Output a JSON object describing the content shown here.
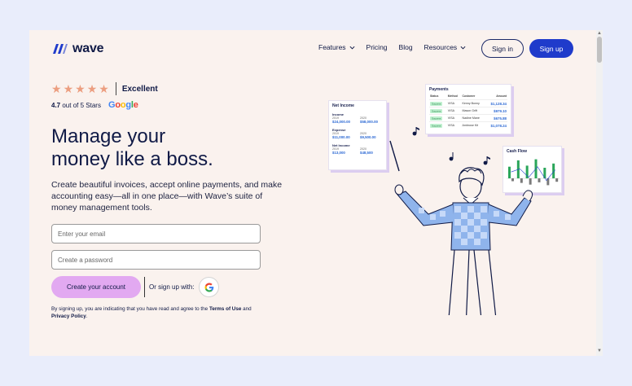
{
  "brand": {
    "name": "wave"
  },
  "nav": {
    "items": [
      {
        "label": "Features",
        "has_dropdown": true
      },
      {
        "label": "Pricing",
        "has_dropdown": false
      },
      {
        "label": "Blog",
        "has_dropdown": false
      },
      {
        "label": "Resources",
        "has_dropdown": true
      }
    ],
    "sign_in": "Sign in",
    "sign_up": "Sign up"
  },
  "rating": {
    "stars": 5,
    "label": "Excellent",
    "score": "4.7",
    "score_suffix": "out of 5 Stars",
    "source": "Google"
  },
  "hero": {
    "title_line1": "Manage your",
    "title_line2": "money like a boss.",
    "description": "Create beautiful invoices, accept online payments, and make accounting easy—all in one place—with Wave’s suite of money management tools."
  },
  "form": {
    "email_placeholder": "Enter your email",
    "password_placeholder": "Create a password",
    "create_label": "Create your account",
    "or_label": "Or sign up with:",
    "terms_prefix": "By signing up, you are indicating that you have read and agree to the ",
    "terms_link": "Terms of Use",
    "terms_and": " and ",
    "privacy_link": "Privacy Policy",
    "terms_suffix": "."
  },
  "illustration": {
    "payments": {
      "title": "Payments",
      "headers": [
        "Status",
        "Method",
        "Customer",
        "Amount"
      ],
      "rows": [
        {
          "status": "Success",
          "method": "VISA",
          "customer": "Kenny Bonny",
          "amount": "$1,128.34"
        },
        {
          "status": "Success",
          "method": "VISA",
          "customer": "Mason Grift",
          "amount": "$979.10"
        },
        {
          "status": "Success",
          "method": "VISA",
          "customer": "Nadine Mane",
          "amount": "$675.88"
        },
        {
          "status": "Success",
          "method": "VISA",
          "customer": "Ambrose Kit",
          "amount": "$1,078.24"
        }
      ]
    },
    "net_income_card": {
      "title": "Net Income",
      "sections": [
        {
          "label": "Income",
          "y1": "2019",
          "y2": "2020",
          "v1": "$24,000.00",
          "v2": "$58,000.00"
        },
        {
          "label": "Expense",
          "y1": "2019",
          "y2": "2020",
          "v1": "$11,000.00",
          "v2": "$9,500.00"
        },
        {
          "label": "Net Income",
          "y1": "2019",
          "y2": "2020",
          "v1": "$13,000",
          "v2": "$48,500"
        }
      ]
    },
    "cash_flow": {
      "title": "Cash Flow",
      "bars": [
        {
          "inflow": 0.55,
          "outflow": 0.25
        },
        {
          "inflow": 0.85,
          "outflow": 0.4
        },
        {
          "inflow": 0.6,
          "outflow": 0.55
        },
        {
          "inflow": 0.9,
          "outflow": 0.35
        },
        {
          "inflow": 0.5,
          "outflow": 0.6
        },
        {
          "inflow": 0.7,
          "outflow": 0.3
        }
      ],
      "colors": {
        "inflow": "#2aa65a",
        "outflow": "#7a7a7a",
        "line": "#1f3bcb"
      }
    }
  },
  "colors": {
    "brand_navy": "#101a46",
    "accent_blue": "#1f3bcb",
    "cta_pink": "#e2a9f1",
    "star": "#ec9e80",
    "page_bg": "#faf2ee"
  }
}
